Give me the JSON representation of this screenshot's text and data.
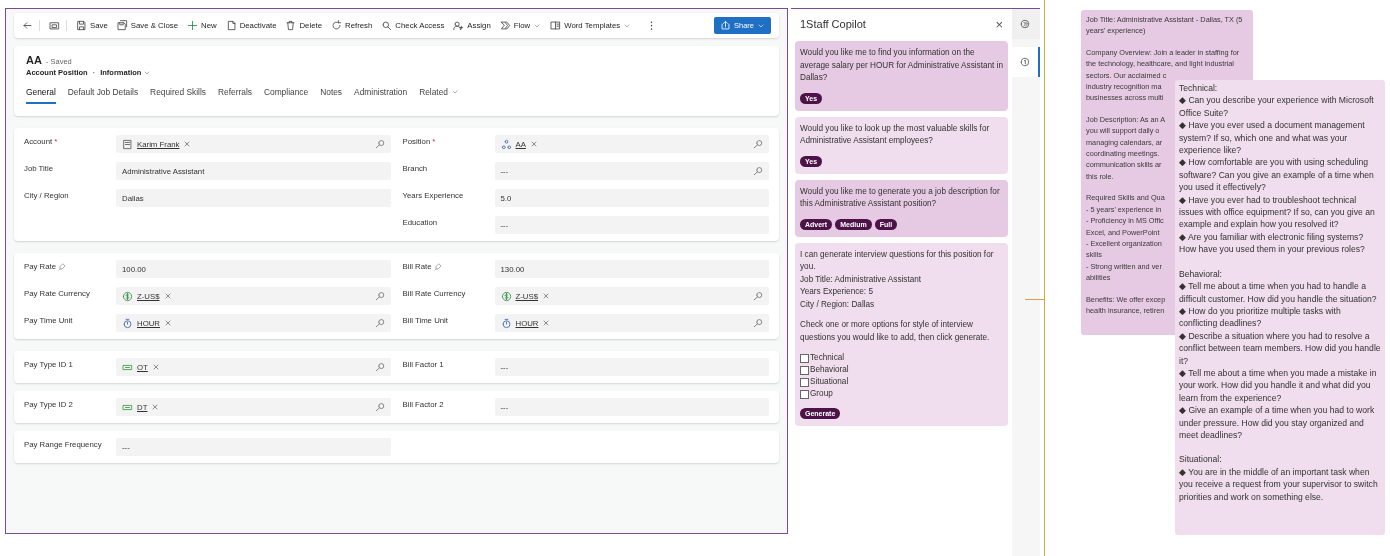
{
  "toolbar": {
    "items": [
      {
        "label": "Save"
      },
      {
        "label": "Save & Close"
      },
      {
        "label": "New"
      },
      {
        "label": "Deactivate"
      },
      {
        "label": "Delete"
      },
      {
        "label": "Refresh"
      },
      {
        "label": "Check Access"
      },
      {
        "label": "Assign"
      },
      {
        "label": "Flow",
        "caret": true
      },
      {
        "label": "Word Templates",
        "caret": true
      }
    ],
    "share": {
      "label": "Share",
      "caret": true
    }
  },
  "header": {
    "title": "AA",
    "status": "- Saved",
    "entity": "Account Position",
    "separator": "·",
    "form": "Information"
  },
  "tabs": [
    {
      "label": "General",
      "selected": true
    },
    {
      "label": "Default Job Details",
      "selected": false
    },
    {
      "label": "Required Skills",
      "selected": false
    },
    {
      "label": "Referrals",
      "selected": false
    },
    {
      "label": "Compliance",
      "selected": false
    },
    {
      "label": "Notes",
      "selected": false
    },
    {
      "label": "Administration",
      "selected": false
    },
    {
      "label": "Related",
      "selected": false,
      "caret": true
    }
  ],
  "required_marker": "*",
  "sections": [
    {
      "left": [
        {
          "label": "Account",
          "required": true,
          "kind": "lookup",
          "value": "Karim Frank"
        },
        {
          "label": "Job Title",
          "kind": "text",
          "value": "Administrative Assistant"
        },
        {
          "label": "City / Region",
          "kind": "text",
          "value": "Dallas"
        }
      ],
      "right": [
        {
          "label": "Position",
          "required": true,
          "kind": "lookup",
          "value": "AA"
        },
        {
          "label": "Branch",
          "kind": "text",
          "value": "---",
          "search": true
        },
        {
          "label": "Years Experience",
          "kind": "text",
          "value": "5.0"
        },
        {
          "label": "Education",
          "kind": "text",
          "value": "---"
        }
      ]
    },
    {
      "left": [
        {
          "label": "Pay Rate",
          "locked": true,
          "kind": "text",
          "value": "100.00"
        },
        {
          "label": "Pay Rate Currency",
          "kind": "lookup",
          "value": "Z-US$"
        },
        {
          "label": "Pay Time Unit",
          "kind": "lookup",
          "value": "HOUR"
        }
      ],
      "right": [
        {
          "label": "Bill Rate",
          "locked": true,
          "kind": "text",
          "value": "130.00"
        },
        {
          "label": "Bill Rate Currency",
          "kind": "lookup",
          "value": "Z-US$"
        },
        {
          "label": "Bill Time Unit",
          "kind": "lookup",
          "value": "HOUR"
        }
      ]
    },
    {
      "left": [
        {
          "label": "Pay Type ID 1",
          "kind": "lookup",
          "value": "OT"
        }
      ],
      "right": [
        {
          "label": "Bill Factor 1",
          "kind": "text",
          "value": "---"
        }
      ]
    },
    {
      "left": [
        {
          "label": "Pay Type ID 2",
          "kind": "lookup",
          "value": "DT"
        }
      ],
      "right": [
        {
          "label": "Bill Factor 2",
          "kind": "text",
          "value": "---"
        }
      ]
    },
    {
      "left": [
        {
          "label": "Pay Range Frequency",
          "kind": "text",
          "value": "---"
        }
      ]
    }
  ],
  "copilot": {
    "title": "1Staff Copilot",
    "close": "×",
    "cards": [
      {
        "color": "#e6c9e2",
        "paragraphs": [
          [
            "Would you like me to find you information on the average salary per HOUR for Administrative Assistant in Dallas?"
          ]
        ],
        "buttons": [
          "Yes"
        ]
      },
      {
        "color": "#f0dded",
        "paragraphs": [
          [
            "Would you like to look up the most valuable skills for Administrative Assistant employees?"
          ]
        ],
        "buttons": [
          "Yes"
        ]
      },
      {
        "color": "#e6c9e2",
        "paragraphs": [
          [
            "Would you like me to generate you a job description for this Administrative Assistant position?"
          ]
        ],
        "buttons": [
          "Advert",
          "Medium",
          "Full"
        ]
      },
      {
        "color": "#f0dded",
        "paragraphs": [
          [
            "I can generate interview questions for this position for you.",
            "Job Title: Administrative Assistant",
            "Years Experience: 5",
            "City / Region: Dallas"
          ],
          [
            "Check one or more options for style of interview questions you would like to add, then click generate."
          ]
        ],
        "options": [
          {
            "label": "Technical",
            "checked": false
          },
          {
            "label": "Behavioral",
            "checked": false
          },
          {
            "label": "Situational",
            "checked": false
          },
          {
            "label": "Group",
            "checked": false
          }
        ],
        "buttons": [
          "Generate"
        ]
      }
    ]
  },
  "rail": [
    {
      "selected": false
    },
    {
      "selected": true
    }
  ],
  "job_description": {
    "paragraphs": [
      [
        "Job Title: Administrative Assistant - Dallas, TX (5",
        "years' experience)"
      ],
      [
        "Company Overview: Join a leader in staffing for",
        "the technology, healthcare, and light industrial",
        "sectors. Our acclaimed c",
        "industry recognition ma",
        "businesses across multi"
      ],
      [
        "Job Description: As an A",
        "you will support daily o",
        "managing calendars, ar",
        "coordinating meetings.",
        "communication skills ar",
        "this role."
      ],
      [
        "Required Skills and Qua",
        "- 5 years' experience in",
        "- Proficiency in MS Offic",
        "Excel, and PowerPoint",
        "- Excellent organization",
        "skills",
        "- Strong written and ver",
        "abilities"
      ],
      [
        "Benefits: We offer excep",
        "health insurance, retiren"
      ]
    ]
  },
  "interview_questions": {
    "sections": [
      {
        "heading": "Technical:",
        "items": [
          "◆ Can you describe your experience with Microsoft Office Suite?",
          "◆ Have you ever used a document management system? If so, which one and what was your experience like?",
          "◆ How comfortable are you with using scheduling software? Can you give an example of a time when you used it effectively?",
          "◆ Have you ever had to troubleshoot technical issues with office equipment? If so, can you give an example and explain how you resolved it?",
          "◆ Are you familiar with electronic filing systems? How have you used them in your previous roles?"
        ]
      },
      {
        "heading": "Behavioral:",
        "items": [
          "◆ Tell me about a time when you had to handle a difficult customer. How did you handle the situation?",
          "◆ How do you prioritize multiple tasks with conflicting deadlines?",
          "◆ Describe a situation where you had to resolve a conflict between team members. How did you handle it?",
          "◆ Tell me about a time when you made a mistake in your work. How did you handle it and what did you learn from the experience?",
          "◆ Give an example of a time when you had to work under pressure. How did you stay organized and meet deadlines?"
        ]
      },
      {
        "heading": "Situational:",
        "items": [
          "◆ You are in the middle of an important task when you receive a request from your supervisor to switch priorities and work on something else."
        ]
      }
    ]
  }
}
